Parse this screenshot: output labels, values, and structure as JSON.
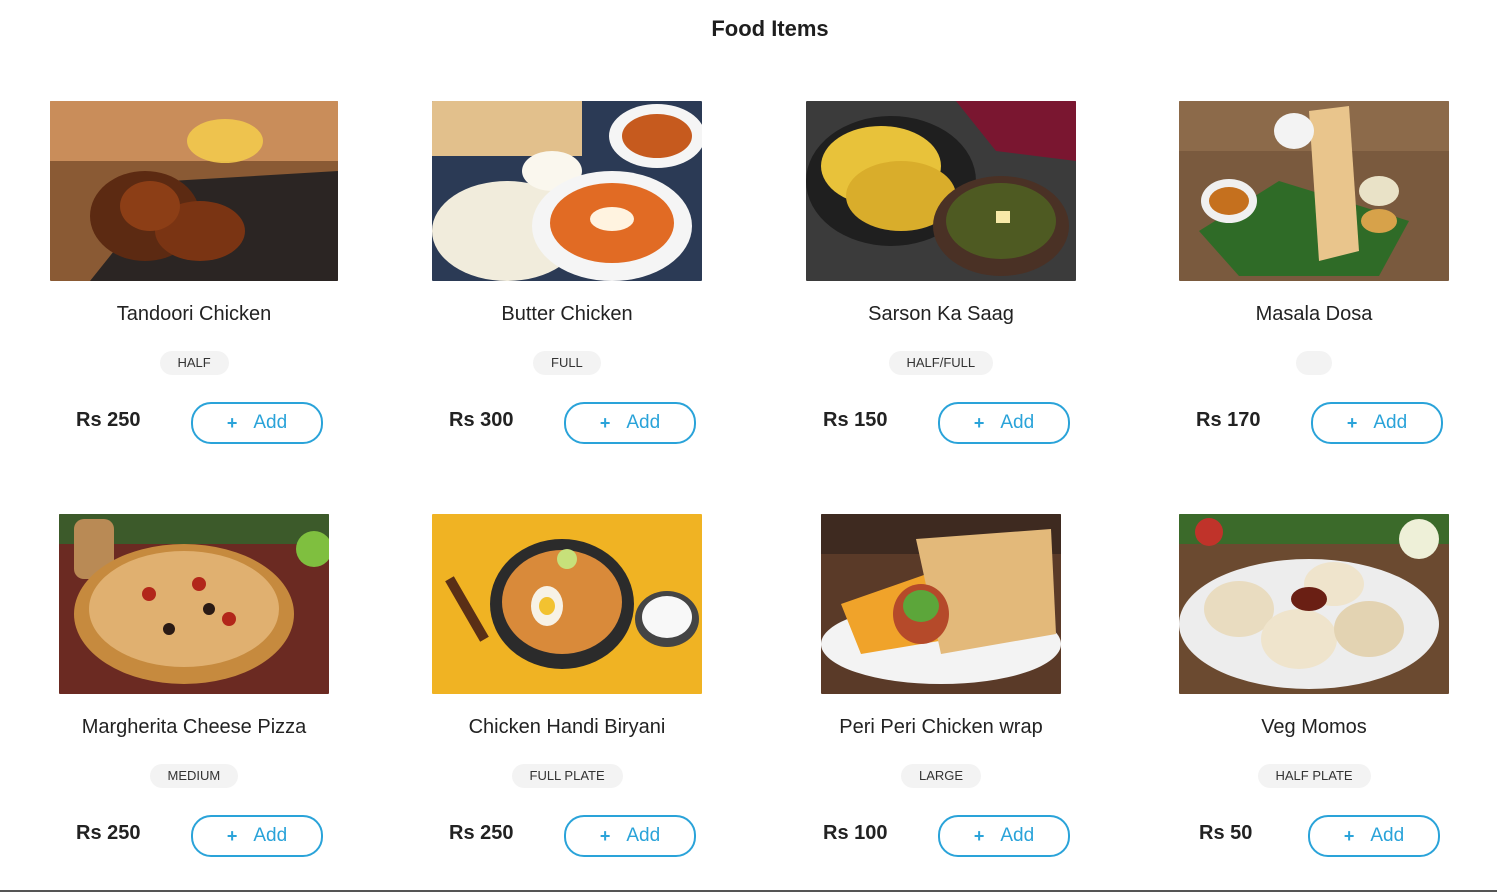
{
  "page": {
    "title": "Food Items"
  },
  "items": [
    {
      "name": "Tandoori Chicken",
      "tag": "HALF",
      "price": "Rs 250",
      "add_label": "Add",
      "plus": "+",
      "image_icon": "tandoori-chicken-photo"
    },
    {
      "name": "Butter Chicken",
      "tag": "FULL",
      "price": "Rs 300",
      "add_label": "Add",
      "plus": "+",
      "image_icon": "butter-chicken-photo"
    },
    {
      "name": "Sarson Ka Saag",
      "tag": "HALF/FULL",
      "price": "Rs 150",
      "add_label": "Add",
      "plus": "+",
      "image_icon": "sarson-ka-saag-photo"
    },
    {
      "name": "Masala Dosa",
      "tag": "",
      "price": "Rs 170",
      "add_label": "Add",
      "plus": "+",
      "image_icon": "masala-dosa-photo"
    },
    {
      "name": "Margherita Cheese Pizza",
      "tag": "MEDIUM",
      "price": "Rs 250",
      "add_label": "Add",
      "plus": "+",
      "image_icon": "pizza-photo"
    },
    {
      "name": "Chicken Handi Biryani",
      "tag": "FULL PLATE",
      "price": "Rs 250",
      "add_label": "Add",
      "plus": "+",
      "image_icon": "biryani-photo"
    },
    {
      "name": "Peri Peri Chicken wrap",
      "tag": "LARGE",
      "price": "Rs 100",
      "add_label": "Add",
      "plus": "+",
      "image_icon": "chicken-wrap-photo"
    },
    {
      "name": "Veg Momos",
      "tag": "HALF PLATE",
      "price": "Rs 50",
      "add_label": "Add",
      "plus": "+",
      "image_icon": "momos-photo"
    }
  ],
  "colors": {
    "accent": "#2aa3d9",
    "tag_bg": "#f3f3f3"
  }
}
